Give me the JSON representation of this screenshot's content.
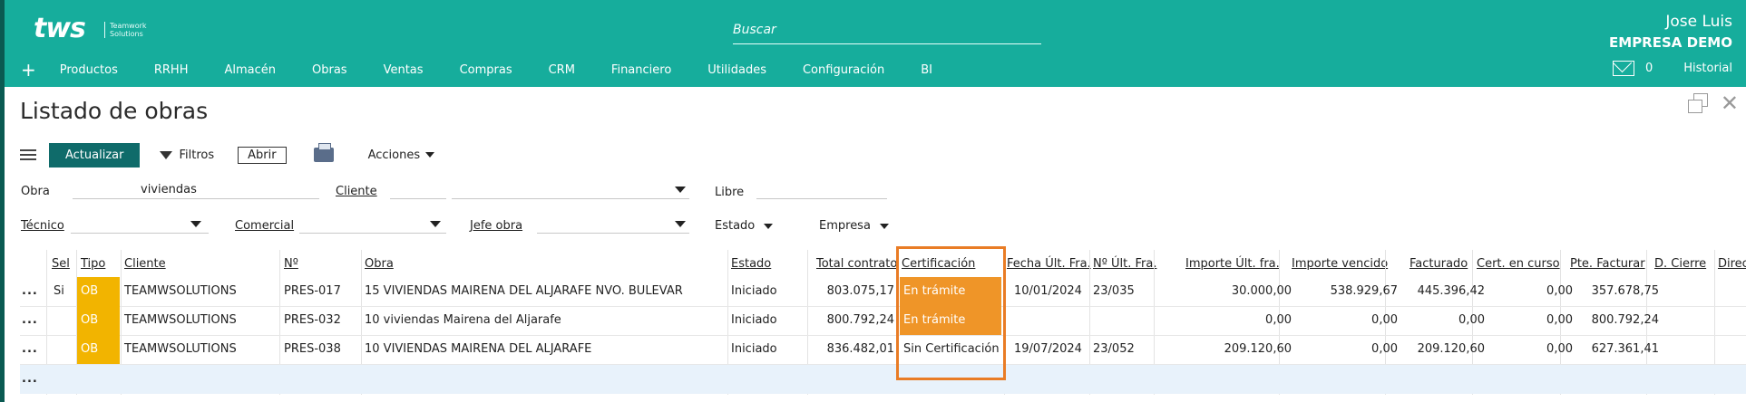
{
  "header": {
    "logo_text": "tws",
    "logo_tagline": "Teamwork Solutions",
    "search_placeholder": "Buscar",
    "user_name": "Jose Luis",
    "company": "EMPRESA DEMO",
    "plus": "+",
    "nav": [
      "Productos",
      "RRHH",
      "Almacén",
      "Obras",
      "Ventas",
      "Compras",
      "CRM",
      "Financiero",
      "Utilidades",
      "Configuración",
      "BI"
    ],
    "mail_count": "0",
    "history": "Historial"
  },
  "page": {
    "title": "Listado de obras"
  },
  "toolbar": {
    "refresh": "Actualizar",
    "filters": "Filtros",
    "open": "Abrir",
    "actions": "Acciones"
  },
  "filters": {
    "obra_label": "Obra",
    "obra_value": "viviendas",
    "cliente_label": "Cliente",
    "cliente_value": "",
    "libre_label": "Libre",
    "libre_value": "",
    "tecnico_label": "Técnico",
    "comercial_label": "Comercial",
    "jefe_label": "Jefe obra",
    "estado_label": "Estado",
    "empresa_label": "Empresa"
  },
  "table": {
    "columns": [
      "Sel",
      "Tipo",
      "Cliente",
      "Nº",
      "Obra",
      "Estado",
      "Total contrato",
      "Certificación",
      "Fecha Últ. Fra.",
      "Nº Últ. Fra.",
      "Importe Últ. fra.",
      "Importe vencido",
      "Facturado",
      "Cert. en curso",
      "Pte. Facturar",
      "D. Cierre",
      "Direc"
    ],
    "rows": [
      {
        "menu": "...",
        "sel": "Si",
        "tipo": "OB",
        "cliente": "TEAMWSOLUTIONS",
        "num": "PRES-017",
        "obra": "15 VIVIENDAS MAIRENA DEL ALJARAFE NVO. BULEVAR",
        "estado": "Iniciado",
        "total": "803.075,17",
        "cert": "En trámite",
        "fecha": "10/01/2024",
        "nfra": "23/035",
        "imp_ult": "30.000,00",
        "imp_venc": "538.929,67",
        "facturado": "445.396,42",
        "cert_curso": "0,00",
        "pte": "357.678,75"
      },
      {
        "menu": "...",
        "sel": "",
        "tipo": "OB",
        "cliente": "TEAMWSOLUTIONS",
        "num": "PRES-032",
        "obra": "10 viviendas Mairena del Aljarafe",
        "estado": "Iniciado",
        "total": "800.792,24",
        "cert": "En trámite",
        "fecha": "",
        "nfra": "",
        "imp_ult": "0,00",
        "imp_venc": "0,00",
        "facturado": "0,00",
        "cert_curso": "0,00",
        "pte": "800.792,24"
      },
      {
        "menu": "...",
        "sel": "",
        "tipo": "OB",
        "cliente": "TEAMWSOLUTIONS",
        "num": "PRES-038",
        "obra": "10 VIVIENDAS MAIRENA DEL ALJARAFE",
        "estado": "Iniciado",
        "total": "836.482,01",
        "cert": "Sin Certificación",
        "fecha": "19/07/2024",
        "nfra": "23/052",
        "imp_ult": "209.120,60",
        "imp_venc": "0,00",
        "facturado": "209.120,60",
        "cert_curso": "0,00",
        "pte": "627.361,41"
      }
    ],
    "new_row_menu": "..."
  },
  "colors": {
    "header": "#16ad9c",
    "primary_button": "#0f6b6a",
    "tipo_badge": "#f2b400",
    "cert_pending": "#ef9528",
    "highlight_border": "#e97c25",
    "new_row": "#e8f2fb"
  },
  "icons": [
    "menu-icon",
    "filter-icon",
    "printer-icon",
    "mail-icon",
    "restore-window-icon",
    "close-icon"
  ]
}
